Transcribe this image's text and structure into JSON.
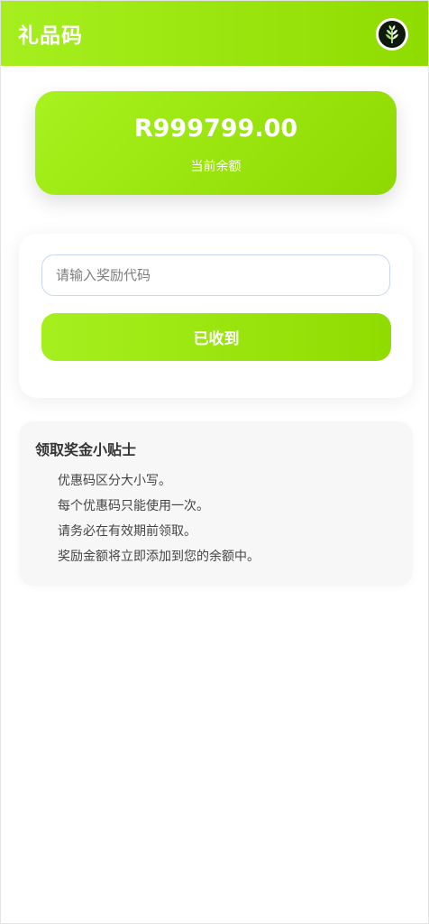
{
  "header": {
    "title": "礼品码",
    "logo_icon": "wheat-logo-icon"
  },
  "balance": {
    "amount": "R999799.00",
    "label": "当前余额"
  },
  "redeem": {
    "input_value": "",
    "input_placeholder": "请输入奖励代码",
    "submit_label": "已收到"
  },
  "tips": {
    "title": "领取奖金小贴士",
    "items": [
      "优惠码区分大小写。",
      "每个优惠码只能使用一次。",
      "请务必在有效期前领取。",
      "奖励金额将立即添加到您的余额中。"
    ]
  },
  "colors": {
    "accent": "#9be50f",
    "accent_light": "#a7f21f",
    "input_border": "#c8d6f2",
    "tips_background": "#f7f7f7"
  }
}
